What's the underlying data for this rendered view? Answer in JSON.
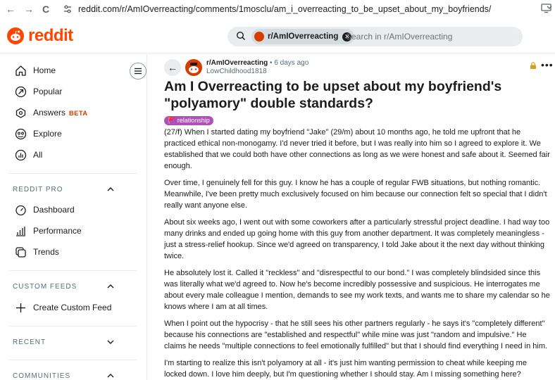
{
  "browser": {
    "back": "←",
    "forward": "→",
    "reload": "C",
    "url": "reddit.com/r/AmIOverreacting/comments/1mosclu/am_i_overreacting_to_be_upset_about_my_boyfriends/"
  },
  "header": {
    "logo_text": "reddit",
    "search": {
      "chip_label": "r/AmIOverreacting",
      "chip_close": "✕",
      "placeholder": "Search in r/AmIOverreacting"
    }
  },
  "sidebar": {
    "nav": [
      {
        "label": "Home",
        "icon": "home-icon"
      },
      {
        "label": "Popular",
        "icon": "popular-icon"
      },
      {
        "label": "Answers",
        "badge": "BETA",
        "icon": "answers-icon"
      },
      {
        "label": "Explore",
        "icon": "explore-icon"
      },
      {
        "label": "All",
        "icon": "all-icon"
      }
    ],
    "reddit_pro": {
      "heading": "REDDIT PRO",
      "items": [
        {
          "label": "Dashboard",
          "icon": "dashboard-icon"
        },
        {
          "label": "Performance",
          "icon": "performance-icon"
        },
        {
          "label": "Trends",
          "icon": "trends-icon"
        }
      ]
    },
    "custom_feeds": {
      "heading": "CUSTOM FEEDS",
      "items": [
        {
          "label": "Create Custom Feed",
          "icon": "plus-icon"
        }
      ]
    },
    "recent": {
      "heading": "RECENT"
    },
    "communities": {
      "heading": "COMMUNITIES"
    }
  },
  "post": {
    "subreddit": "r/AmIOverreacting",
    "time": "• 6 days ago",
    "author": "LowChildhood1818",
    "title": "Am I Overreacting to be upset about my boyfriend's \"polyamory\" double standards?",
    "flair": "🚩 relationship",
    "paragraphs": [
      "(27/f) When I started dating my boyfriend \"Jake\" (29/m) about 10 months ago, he told me upfront that he practiced ethical non-monogamy. I'd never tried it before, but I was really into him so I agreed to explore it. We established that we could both have other connections as long as we were honest and safe about it. Seemed fair enough.",
      "Over time, I genuinely fell for this guy. I know he has a couple of regular FWB situations, but nothing romantic. Meanwhile, I've been pretty much exclusively focused on him because our connection felt so special that I didn't really want anyone else.",
      "About six weeks ago, I went out with some coworkers after a particularly stressful project deadline. I had way too many drinks and ended up going home with this guy from another department. It was completely meaningless - just a stress-relief hookup. Since we'd agreed on transparency, I told Jake about it the next day without thinking twice.",
      "He absolutely lost it. Called it \"reckless\" and \"disrespectful to our bond.\" I was completely blindsided since this was literally what we'd agreed to. Now he's become incredibly possessive and suspicious. He interrogates me about every male colleague I mention, demands to see my work texts, and wants me to share my calendar so he knows where I am at all times.",
      "When I point out the hypocrisy - that he still sees his other partners regularly - he says it's \"completely different\" because his connections are \"established and respectful\" while mine was just \"random and impulsive.\" He claims he needs \"multiple connections to feel emotionally fulfilled\" but that I should find everything I need in him.",
      "I'm starting to realize this isn't polyamory at all - it's just him wanting permission to cheat while keeping me locked down. I love him deeply, but I'm questioning whether I should stay. Am I missing something here?"
    ]
  },
  "colors": {
    "brand": "#ff4500",
    "flair": "#b04fb9",
    "lock": "#d4a019"
  }
}
